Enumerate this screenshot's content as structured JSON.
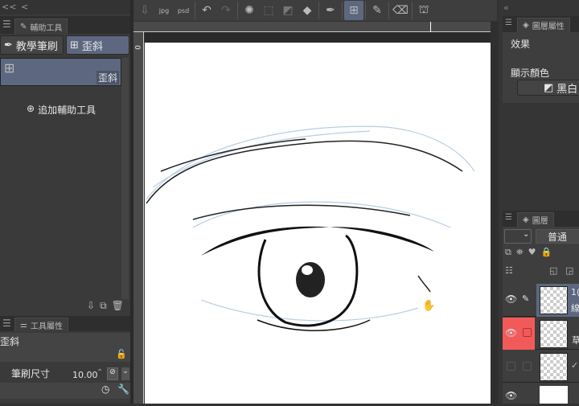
{
  "left_panel": {
    "collapse_icons": [
      "<<",
      "<"
    ],
    "assist_tab": "輔助工具",
    "subtool_buttons": [
      {
        "label": "教學筆刷",
        "selected": false
      },
      {
        "label": "歪斜",
        "selected": true
      }
    ],
    "selected_item_label": "歪斜",
    "add_assist_tool": "追加輔助工具",
    "tool_property_tab": "工具屬性",
    "tool_property_name": "歪斜",
    "brush_size_label": "筆刷尺寸",
    "brush_size_value": "10.00"
  },
  "toolbar": {
    "jpg": "jpg",
    "psd": "psd"
  },
  "ruler": {
    "zero": "0"
  },
  "right_panel": {
    "layer_property_tab": "圖層屬性",
    "effect_label": "效果",
    "display_color_label": "顯示顏色",
    "display_color_button": "黑白",
    "layers_tab": "圖層",
    "blend_mode": "普通",
    "layers": [
      {
        "name_partial": "1(",
        "sub": "線",
        "visible": true,
        "editing": true,
        "selected": true
      },
      {
        "name_partial": "",
        "sub": "草",
        "visible": true,
        "editing": false,
        "draft": true
      },
      {
        "name_partial": "",
        "sub": "✓",
        "visible": false
      },
      {
        "name_partial": "",
        "sub": "",
        "visible": true,
        "paper": true
      }
    ]
  },
  "colors": {
    "panel": "#3a3a3a",
    "selected": "#5d6880",
    "draft_red": "#f25a5a"
  }
}
